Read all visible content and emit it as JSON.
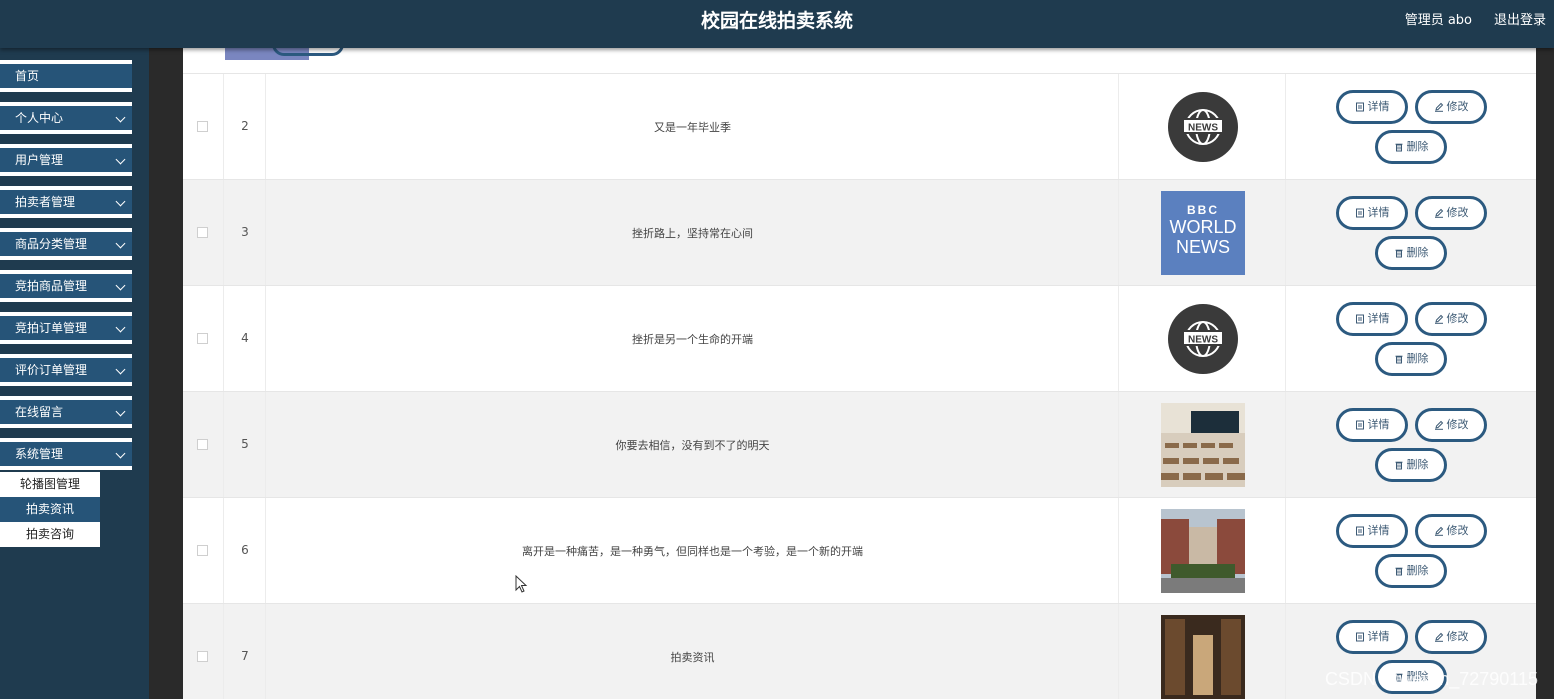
{
  "app": {
    "title": "校园在线拍卖系统",
    "user": "管理员 abo",
    "logout": "退出登录"
  },
  "sidebar": {
    "items": [
      {
        "label": "首页",
        "has_chevron": false
      },
      {
        "label": "个人中心",
        "has_chevron": true
      },
      {
        "label": "用户管理",
        "has_chevron": true
      },
      {
        "label": "拍卖者管理",
        "has_chevron": true
      },
      {
        "label": "商品分类管理",
        "has_chevron": true
      },
      {
        "label": "竞拍商品管理",
        "has_chevron": true
      },
      {
        "label": "竞拍订单管理",
        "has_chevron": true
      },
      {
        "label": "评价订单管理",
        "has_chevron": true
      },
      {
        "label": "在线留言",
        "has_chevron": true
      },
      {
        "label": "系统管理",
        "has_chevron": true
      }
    ],
    "submenu": [
      {
        "label": "轮播图管理"
      },
      {
        "label": "拍卖资讯",
        "active": true
      },
      {
        "label": "拍卖咨询"
      }
    ]
  },
  "table": {
    "actions": {
      "detail": "详情",
      "edit": "修改",
      "delete": "删除"
    },
    "rows": [
      {
        "index": "2",
        "title": "又是一年毕业季",
        "image": "news-globe"
      },
      {
        "index": "3",
        "title": "挫折路上，坚持常在心间",
        "image": "bbc-world-news"
      },
      {
        "index": "4",
        "title": "挫折是另一个生命的开端",
        "image": "news-globe"
      },
      {
        "index": "5",
        "title": "你要去相信，没有到不了的明天",
        "image": "classroom-photo"
      },
      {
        "index": "6",
        "title": "离开是一种痛苦，是一种勇气，但同样也是一个考验，是一个新的开端",
        "image": "campus-building-photo"
      },
      {
        "index": "7",
        "title": "拍卖资讯",
        "image": "library-photo"
      }
    ]
  },
  "bbc_logo": {
    "line1": "BBC",
    "line2": "WORLD",
    "line3": "NEWS"
  },
  "news_logo": {
    "text": "NEWS"
  },
  "watermark": "CSDN @weixin_72790115",
  "colors": {
    "header": "#1f3b4f",
    "menu": "#265478",
    "button_border": "#2c5a80"
  }
}
